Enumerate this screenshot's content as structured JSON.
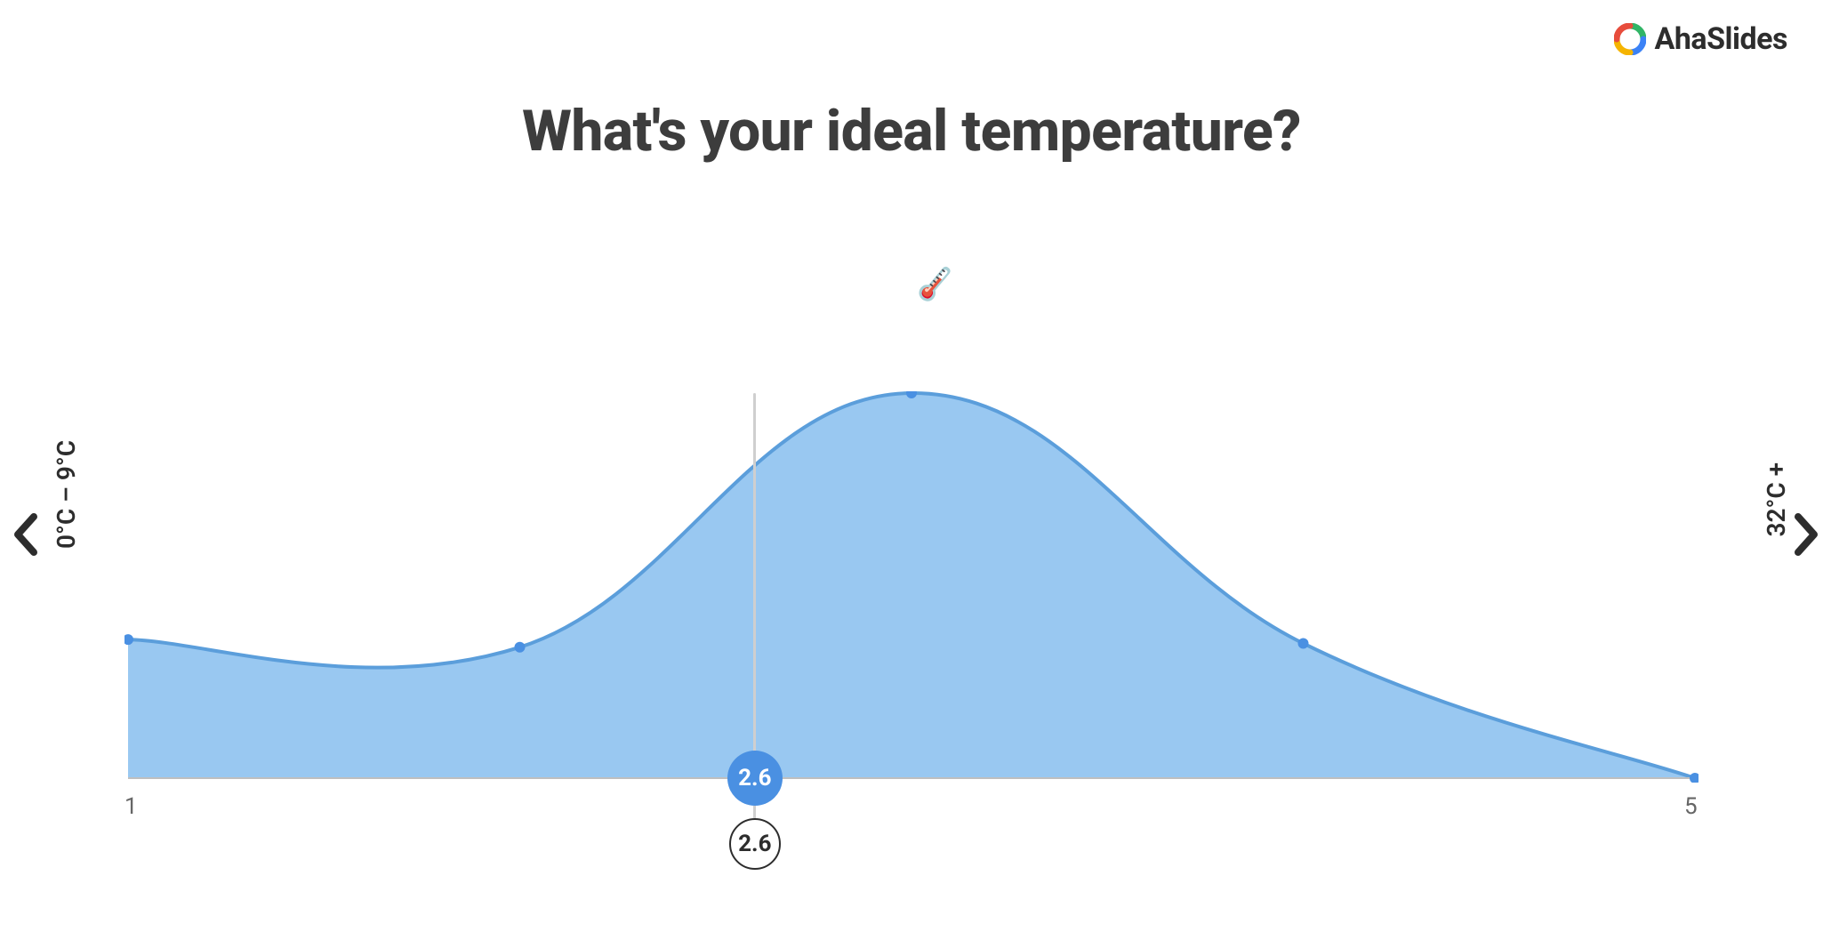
{
  "brand": {
    "name": "AhaSlides"
  },
  "title": "What's your ideal temperature?",
  "thermometer_icon": "🌡️",
  "nav": {
    "prev_icon": "‹",
    "next_icon": "›"
  },
  "axis": {
    "left_label": "0°C – 9°C",
    "right_label": "32°C +",
    "x_min_label": "1",
    "x_max_label": "5"
  },
  "mean": {
    "value_top": "2.6",
    "value_bottom": "2.6",
    "x_position": 2.6
  },
  "colors": {
    "area_fill": "#8ec2ef",
    "area_stroke": "#5b9edb",
    "point_fill": "#4a90e2",
    "axis_line": "#bfbfbf",
    "badge_filled_bg": "#4a90e2",
    "badge_outline_border": "#2d2d2d"
  },
  "chart_data": {
    "type": "area",
    "title": "What's your ideal temperature?",
    "xlabel": "",
    "ylabel": "",
    "xlim": [
      1,
      5
    ],
    "ylim": [
      0,
      1
    ],
    "x": [
      1,
      2,
      3,
      4,
      5
    ],
    "values": [
      0.36,
      0.34,
      1.0,
      0.35,
      0.0
    ],
    "mean": 2.6,
    "x_tick_labels": [
      "1",
      "5"
    ],
    "left_end_label": "0°C – 9°C",
    "right_end_label": "32°C +"
  }
}
